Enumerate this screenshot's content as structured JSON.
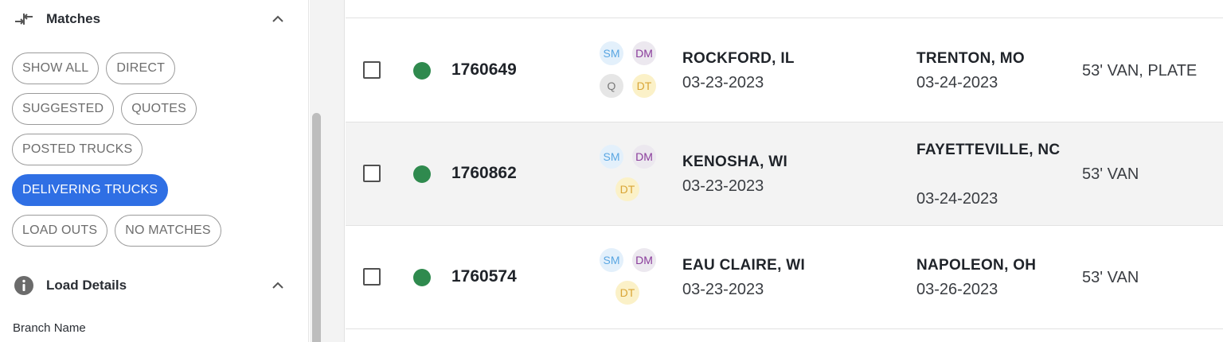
{
  "sidebar": {
    "matches": {
      "title": "Matches",
      "icon": "arrows-exchange-icon",
      "collapse_icon": "chevron-up-icon",
      "chip_rows": [
        [
          {
            "label": "SHOW ALL",
            "active": false
          },
          {
            "label": "DIRECT",
            "active": false
          }
        ],
        [
          {
            "label": "SUGGESTED",
            "active": false
          },
          {
            "label": "QUOTES",
            "active": false
          }
        ],
        [
          {
            "label": "POSTED TRUCKS",
            "active": false
          }
        ],
        [
          {
            "label": "DELIVERING TRUCKS",
            "active": true
          }
        ],
        [
          {
            "label": "LOAD OUTS",
            "active": false
          },
          {
            "label": "NO MATCHES",
            "active": false
          }
        ]
      ]
    },
    "load_details": {
      "title": "Load Details",
      "icon": "info-icon",
      "collapse_icon": "chevron-up-icon",
      "branch_label": "Branch Name"
    }
  },
  "colors": {
    "accent": "#2f6fe4",
    "status_green": "#2f8a4e",
    "alt_row": "#f3f3f3"
  },
  "loads": [
    {
      "id": "1760649",
      "badges": [
        "SM",
        "DM",
        "Q",
        "DT"
      ],
      "origin_city": "ROCKFORD, IL",
      "origin_date": "03-23-2023",
      "dest_city": "TRENTON, MO",
      "dest_date": "03-24-2023",
      "equipment": "53' VAN, PLATE"
    },
    {
      "id": "1760862",
      "badges": [
        "SM",
        "DM",
        "DT"
      ],
      "origin_city": "KENOSHA, WI",
      "origin_date": "03-23-2023",
      "dest_city": "FAYETTEVILLE, NC",
      "dest_date": "03-24-2023",
      "equipment": "53' VAN"
    },
    {
      "id": "1760574",
      "badges": [
        "SM",
        "DM",
        "DT"
      ],
      "origin_city": "EAU CLAIRE, WI",
      "origin_date": "03-23-2023",
      "dest_city": "NAPOLEON, OH",
      "dest_date": "03-26-2023",
      "equipment": "53' VAN"
    }
  ]
}
